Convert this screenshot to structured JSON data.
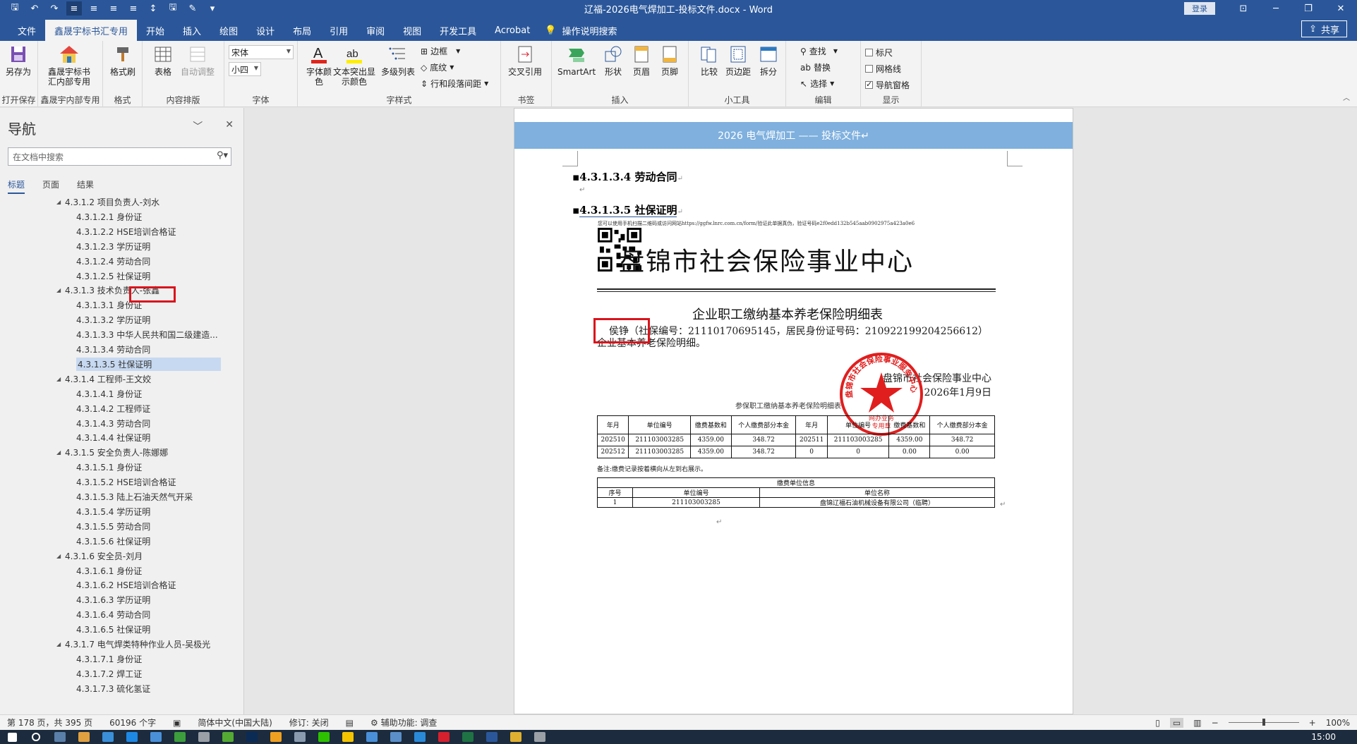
{
  "window": {
    "title": "辽福-2026电气焊加工-投标文件.docx  -  Word",
    "login": "登录",
    "minimize": "─",
    "restore": "❐",
    "close": "✕",
    "ribbon_display": "⊡"
  },
  "quick_access": [
    {
      "name": "save-icon",
      "glyph": "🖫"
    },
    {
      "name": "undo-icon",
      "glyph": "↶"
    },
    {
      "name": "redo-icon",
      "glyph": "↷"
    },
    {
      "name": "align-left-icon",
      "glyph": "≡"
    },
    {
      "name": "align-center-icon",
      "glyph": "≡"
    },
    {
      "name": "align-right-icon",
      "glyph": "≡"
    },
    {
      "name": "justify-icon",
      "glyph": "≡"
    },
    {
      "name": "line-spacing-icon",
      "glyph": "↕"
    },
    {
      "name": "save-as-icon",
      "glyph": "🖫"
    },
    {
      "name": "format-painter-icon",
      "glyph": "✎"
    },
    {
      "name": "customize-icon",
      "glyph": "▾"
    }
  ],
  "tabs": [
    "文件",
    "鑫晟宇标书汇专用",
    "开始",
    "插入",
    "绘图",
    "设计",
    "布局",
    "引用",
    "审阅",
    "视图",
    "开发工具",
    "Acrobat"
  ],
  "active_tab_index": 1,
  "tell_me": "操作说明搜索",
  "share": "共享",
  "ribbon": {
    "save_as": "另存为",
    "open_save": "打开保存",
    "xsy_btn": "鑫晟宇标书\n汇内部专用",
    "xsy_group": "鑫晟宇内部专用",
    "format_brush": "格式刷",
    "format_group": "格式",
    "table": "表格",
    "auto_adjust": "自动调整",
    "content_group": "内容排版",
    "font_name": "宋体",
    "font_size": "小四",
    "font_group": "字体",
    "font_color": "字体颜\n色",
    "highlight": "文本突出显\n示颜色",
    "multilevel": "多级列表",
    "border": "边框",
    "shading": "底纹",
    "spacing": "行和段落间距",
    "style_group": "字样式",
    "cross_ref": "交叉引用",
    "bookmark_group": "书签",
    "smartart": "SmartArt",
    "shape": "形状",
    "header": "页眉",
    "footer": "页脚",
    "insert_group": "插入",
    "compare": "比较",
    "margins": "页边距",
    "split": "拆分",
    "tools_group": "小工具",
    "find": "查找",
    "replace": "替换",
    "select": "选择",
    "edit_group": "编辑",
    "ruler": "标尺",
    "gridlines": "网格线",
    "nav_pane": "导航窗格",
    "show_group": "显示"
  },
  "nav": {
    "title": "导航",
    "search_placeholder": "在文档中搜索",
    "tabs": [
      "标题",
      "页面",
      "结果"
    ],
    "items": [
      {
        "level": 1,
        "text": "4.3.1.2 项目负责人-刘水"
      },
      {
        "level": 2,
        "text": "4.3.1.2.1 身份证"
      },
      {
        "level": 2,
        "text": "4.3.1.2.2 HSE培训合格证"
      },
      {
        "level": 2,
        "text": "4.3.1.2.3 学历证明"
      },
      {
        "level": 2,
        "text": "4.3.1.2.4 劳动合同"
      },
      {
        "level": 2,
        "text": "4.3.1.2.5 社保证明"
      },
      {
        "level": 1,
        "text": "4.3.1.3 技术负责人-张鑫"
      },
      {
        "level": 2,
        "text": "4.3.1.3.1 身份证"
      },
      {
        "level": 2,
        "text": "4.3.1.3.2 学历证明"
      },
      {
        "level": 2,
        "text": "4.3.1.3.3 中华人民共和国二级建造..."
      },
      {
        "level": 2,
        "text": "4.3.1.3.4 劳动合同"
      },
      {
        "level": 2,
        "text": "4.3.1.3.5 社保证明",
        "selected": true
      },
      {
        "level": 1,
        "text": "4.3.1.4 工程师-王文姣"
      },
      {
        "level": 2,
        "text": "4.3.1.4.1 身份证"
      },
      {
        "level": 2,
        "text": "4.3.1.4.2 工程师证"
      },
      {
        "level": 2,
        "text": "4.3.1.4.3 劳动合同"
      },
      {
        "level": 2,
        "text": "4.3.1.4.4 社保证明"
      },
      {
        "level": 1,
        "text": "4.3.1.5 安全负责人-陈娜娜"
      },
      {
        "level": 2,
        "text": "4.3.1.5.1 身份证"
      },
      {
        "level": 2,
        "text": "4.3.1.5.2 HSE培训合格证"
      },
      {
        "level": 2,
        "text": "4.3.1.5.3 陆上石油天然气开采"
      },
      {
        "level": 2,
        "text": "4.3.1.5.4 学历证明"
      },
      {
        "level": 2,
        "text": "4.3.1.5.5 劳动合同"
      },
      {
        "level": 2,
        "text": "4.3.1.5.6 社保证明"
      },
      {
        "level": 1,
        "text": "4.3.1.6 安全员-刘月"
      },
      {
        "level": 2,
        "text": "4.3.1.6.1 身份证"
      },
      {
        "level": 2,
        "text": "4.3.1.6.2 HSE培训合格证"
      },
      {
        "level": 2,
        "text": "4.3.1.6.3 学历证明"
      },
      {
        "level": 2,
        "text": "4.3.1.6.4 劳动合同"
      },
      {
        "level": 2,
        "text": "4.3.1.6.5 社保证明"
      },
      {
        "level": 1,
        "text": "4.3.1.7 电气焊类特种作业人员-吴极光"
      },
      {
        "level": 2,
        "text": "4.3.1.7.1 身份证"
      },
      {
        "level": 2,
        "text": "4.3.1.7.2 焊工证"
      },
      {
        "level": 2,
        "text": "4.3.1.7.3 硫化氢证"
      }
    ]
  },
  "doc": {
    "header_text": "2026 电气焊加工 —— 投标文件↵",
    "heading1": "4.3.1.3.4 劳动合同",
    "heading2": "4.3.1.3.5 社保证明",
    "para_mark": "↵",
    "verify_line": "您可以使用手机扫描二维码或访问网站https://ggfw.lnrc.com.cn/form/验证此单据真伪，验证号码e2f0edd132b545aab0902975a423a0e6",
    "cert_title": "盘锦市社会保险事业中心",
    "cert_subtitle": "企业职工缴纳基本养老保险明细表",
    "cert_body_name": "侯铮",
    "cert_body_rest": "（社保编号：21110170695145，居民身份证号码：210922199204256612） 企业基本养老保险明细。",
    "cert_sign_org": "盘锦市社会保险事业中心",
    "cert_sign_date": "2026年1月9日",
    "stamp_text": "盘锦市社会保险事业服务中心",
    "stamp_bottom": "网办业务\n专用章",
    "table_caption": "参保职工缴纳基本养老保险明细表",
    "pay_headers": [
      "年月",
      "单位编号",
      "缴费基数和",
      "个人缴费部分本金",
      "年月",
      "单位编号",
      "缴费基数和",
      "个人缴费部分本金"
    ],
    "pay_rows": [
      [
        "202510",
        "211103003285",
        "4359.00",
        "348.72",
        "202511",
        "211103003285",
        "4359.00",
        "348.72"
      ],
      [
        "202512",
        "211103003285",
        "4359.00",
        "348.72",
        "0",
        "0",
        "0.00",
        "0.00"
      ]
    ],
    "note": "备注:缴费记录按着横向从左到右展示。",
    "unit_table_title": "缴费单位信息",
    "unit_headers": [
      "序号",
      "单位编号",
      "单位名称"
    ],
    "unit_row": [
      "1",
      "211103003285",
      "盘锦辽福石油机械设备有限公司（临聘）"
    ]
  },
  "status": {
    "page": "第 178 页，共 395 页",
    "words": "60196 个字",
    "lang": "简体中文(中国大陆)",
    "track": "修订: 关闭",
    "access": "辅助功能: 调查",
    "zoom": "100%"
  },
  "taskbar": {
    "clock": "15:00",
    "icons": [
      {
        "name": "start-icon",
        "color": "#ffffff"
      },
      {
        "name": "search-icon",
        "color": "#ffffff"
      },
      {
        "name": "calculator-icon",
        "color": "#5a7fa8"
      },
      {
        "name": "paint-icon",
        "color": "#e0a040"
      },
      {
        "name": "explorer-icon",
        "color": "#3a8fd8"
      },
      {
        "name": "mail-icon",
        "color": "#1e88e5"
      },
      {
        "name": "browser-icon",
        "color": "#4a90d9"
      },
      {
        "name": "wechat-work-icon",
        "color": "#3c9e3c"
      },
      {
        "name": "notepad-icon",
        "color": "#9aa0a6"
      },
      {
        "name": "sougou-icon",
        "color": "#55aa33"
      },
      {
        "name": "ps-icon",
        "color": "#0b2b55"
      },
      {
        "name": "sunflower-icon",
        "color": "#f0a020"
      },
      {
        "name": "gear-icon",
        "color": "#8a9bb0"
      },
      {
        "name": "wechat-icon",
        "color": "#2dc100"
      },
      {
        "name": "qq-icon",
        "color": "#f5c400"
      },
      {
        "name": "browser2-icon",
        "color": "#4a90d9"
      },
      {
        "name": "network-icon",
        "color": "#5b8fc9"
      },
      {
        "name": "edge-icon",
        "color": "#2a8ad8"
      },
      {
        "name": "acrobat-icon",
        "color": "#d6202e"
      },
      {
        "name": "excel-icon",
        "color": "#1f7244"
      },
      {
        "name": "word-icon",
        "color": "#2b579a"
      },
      {
        "name": "folder-icon",
        "color": "#e0b030"
      },
      {
        "name": "snipping-icon",
        "color": "#9aa0a6"
      }
    ]
  }
}
